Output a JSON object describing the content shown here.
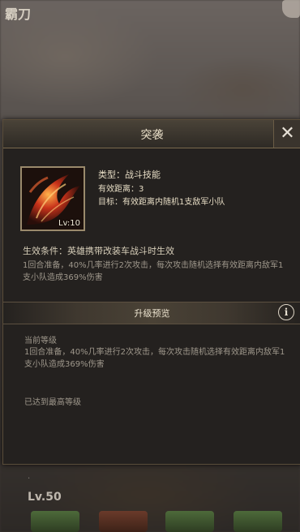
{
  "background": {
    "title": "霸刀",
    "level": "Lv.50"
  },
  "dialog": {
    "title": "突袭",
    "close_icon": "close-icon",
    "skill": {
      "icon": "flame-wing-skill-icon",
      "level": "Lv:10",
      "type": "类型：战斗技能",
      "range": "有效距离：3",
      "target": "目标：有效距离内随机1支敌军小队"
    },
    "condition": "生效条件：英雄携带改装车战斗时生效",
    "description": "1回合准备，40%几率进行2次攻击，每次攻击随机选择有效距离内敌军1支小队造成369%伤害",
    "upgrade_section": {
      "title": "升级预览",
      "info_icon": "info-icon",
      "current_label": "当前等级",
      "current_desc": "1回合准备，40%几率进行2次攻击，每次攻击随机选择有效距离内敌军1支小队造成369%伤害",
      "max_level_text": "已达到最高等级"
    }
  },
  "colors": {
    "accent_gold": "#7a6a4e",
    "panel_bg": "#24211f",
    "text_light": "#e6dcc4",
    "text_muted": "#9f988c"
  }
}
